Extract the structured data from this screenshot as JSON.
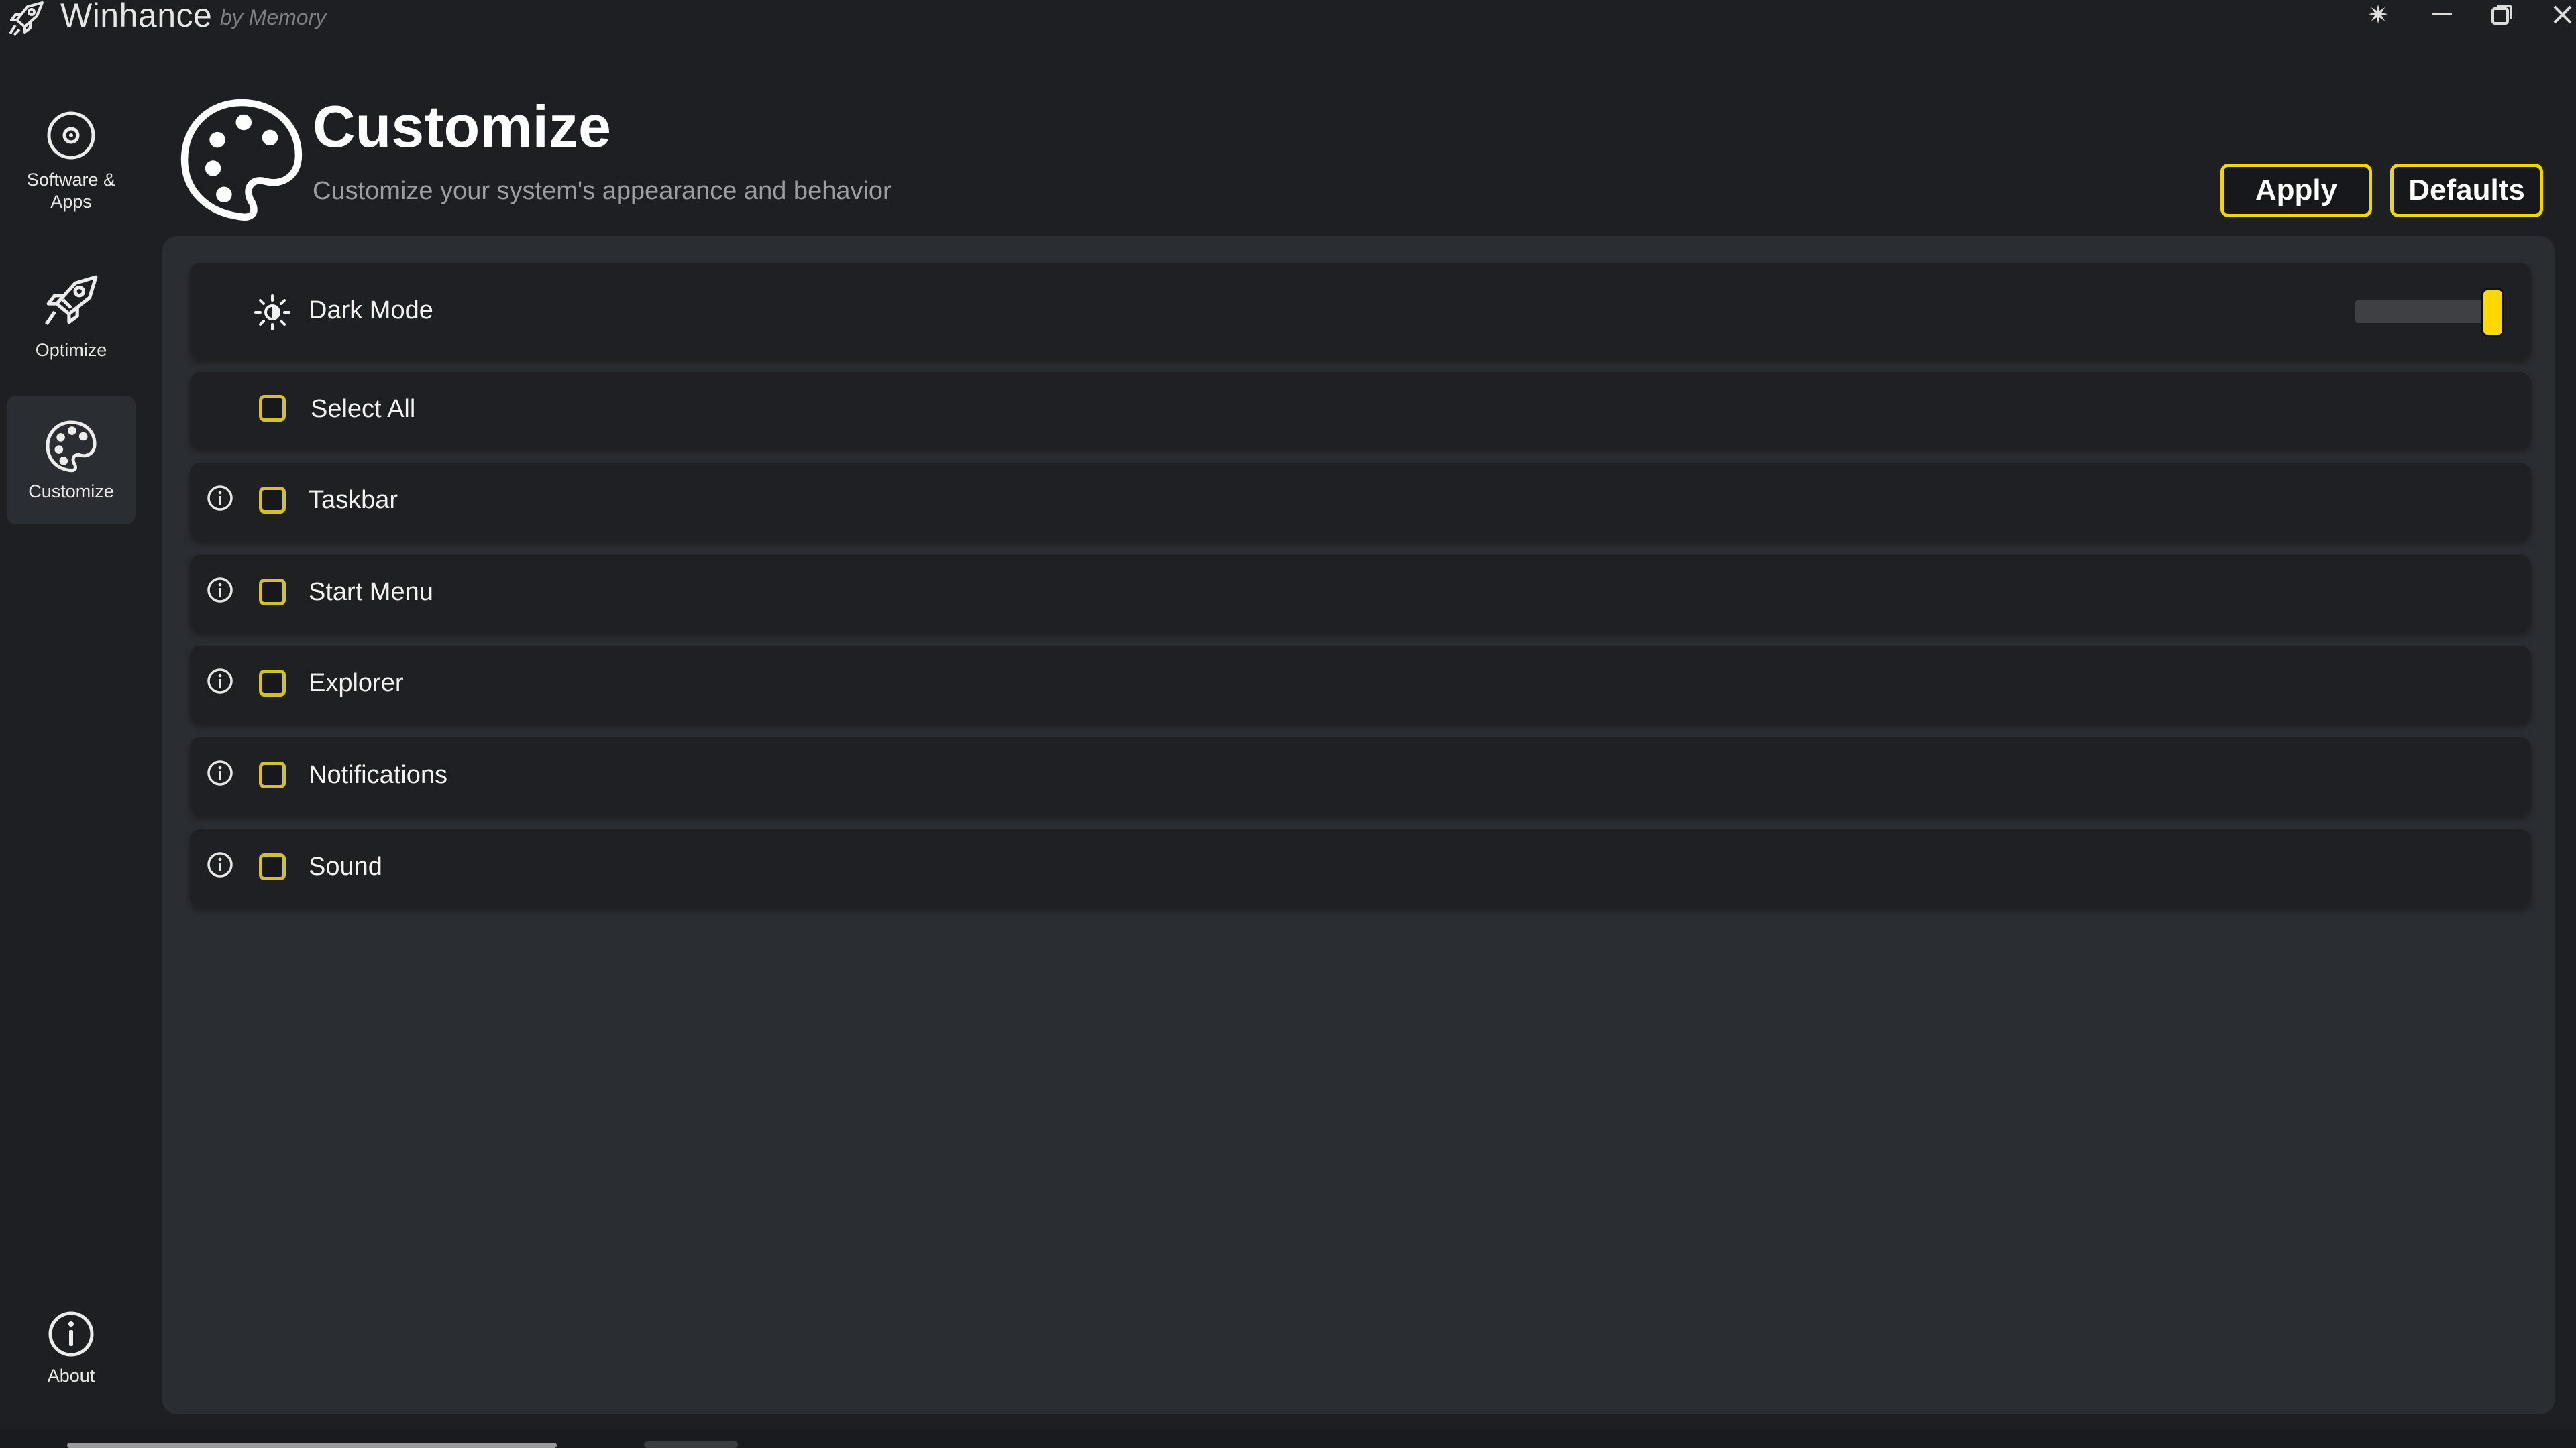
{
  "window": {
    "app_title": "Winhance",
    "app_subtitle": "by Memory",
    "icons": {
      "logo": "rocket-icon",
      "theme": "sun-icon",
      "minimize": "minimize-icon",
      "maximize": "restore-icon",
      "close": "close-icon"
    }
  },
  "sidebar": {
    "items": [
      {
        "label_line1": "Software &",
        "label_line2": "Apps",
        "icon": "disc-icon",
        "selected": false
      },
      {
        "label": "Optimize",
        "icon": "rocket-icon",
        "selected": false
      },
      {
        "label": "Customize",
        "icon": "palette-icon",
        "selected": true
      }
    ],
    "about": {
      "label": "About",
      "icon": "info-icon"
    }
  },
  "header": {
    "icon": "palette-icon",
    "title": "Customize",
    "subtitle": "Customize your system's appearance and behavior",
    "apply_label": "Apply",
    "defaults_label": "Defaults"
  },
  "settings": {
    "dark_mode": {
      "label": "Dark Mode",
      "icon": "sun-icon",
      "slider_value": 1.0
    },
    "select_all": {
      "label": "Select All",
      "checked": false
    },
    "categories": [
      {
        "label": "Taskbar",
        "checked": false
      },
      {
        "label": "Start Menu",
        "checked": false
      },
      {
        "label": "Explorer",
        "checked": false
      },
      {
        "label": "Notifications",
        "checked": false
      },
      {
        "label": "Sound",
        "checked": false
      }
    ]
  },
  "colors": {
    "accent": "#f2d600",
    "background": "#1d1f22",
    "panel": "#2a2d31",
    "row": "#1e2024"
  }
}
